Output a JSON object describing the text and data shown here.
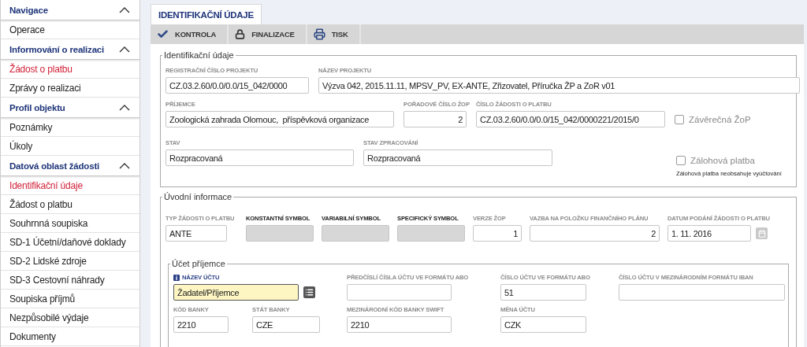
{
  "sidebar": {
    "sections": [
      {
        "title": "Navigace",
        "expanded": true,
        "items": [
          {
            "label": "Operace",
            "selected": false
          }
        ]
      },
      {
        "title": "Informování o realizaci",
        "expanded": true,
        "items": [
          {
            "label": "Žádost o platbu",
            "selected": true
          },
          {
            "label": "Zprávy o realizaci",
            "selected": false
          }
        ]
      },
      {
        "title": "Profil objektu",
        "expanded": true,
        "items": [
          {
            "label": "Poznámky",
            "selected": false
          },
          {
            "label": "Úkoly",
            "selected": false
          }
        ]
      },
      {
        "title": "Datová oblast žádosti",
        "expanded": true,
        "items": [
          {
            "label": "Identifikační údaje",
            "selected": true
          },
          {
            "label": "Žádost o platbu",
            "selected": false
          },
          {
            "label": "Souhrnná soupiska",
            "selected": false
          },
          {
            "label": "SD-1 Účetní/daňové doklady",
            "selected": false
          },
          {
            "label": "SD-2 Lidské zdroje",
            "selected": false
          },
          {
            "label": "SD-3 Cestovní náhrady",
            "selected": false
          },
          {
            "label": "Soupiska příjmů",
            "selected": false
          },
          {
            "label": "Nezpůsobilé výdaje",
            "selected": false
          },
          {
            "label": "Dokumenty",
            "selected": false
          }
        ]
      }
    ]
  },
  "tabs": [
    {
      "label": "IDENTIFIKAČNÍ ÚDAJE",
      "selected": true
    }
  ],
  "toolbar": [
    {
      "kind": "check",
      "label": "KONTROLA"
    },
    {
      "kind": "lock",
      "label": "FINALIZACE"
    },
    {
      "kind": "print",
      "label": "TISK"
    }
  ],
  "identification": {
    "legend": "Identifikační údaje",
    "fields": [
      {
        "label": "REGISTRAČNÍ ČÍSLO PROJEKTU",
        "value": "CZ.03.2.60/0.0/0.0/15_042/0000",
        "kind": "text"
      },
      {
        "label": "NÁZEV PROJEKTU",
        "value": "Výzva 042, 2015.11.11, MPSV_PV, EX-ANTE, Zřizovatel, Příručka ŽP a ZoR v01",
        "kind": "text"
      },
      {
        "label": "PŘÍJEMCE",
        "value": "Zoologická zahrada Olomouc,  příspěvková organizace",
        "kind": "text"
      },
      {
        "label": "POŘADOVÉ ČÍSLO ŽOP",
        "value": "2",
        "kind": "number"
      },
      {
        "label": "ČÍSLO ŽÁDOSTI O PLATBU",
        "value": "CZ.03.2.60/0.0/0.0/15_042/0000221/2015/0",
        "kind": "text"
      },
      {
        "label": "STAV",
        "value": "Rozpracovaná",
        "kind": "text"
      },
      {
        "label": "STAV ZPRACOVÁNÍ",
        "value": "Rozpracovaná",
        "kind": "text"
      }
    ],
    "checkboxes": [
      {
        "label": "Závěrečná ŽoP",
        "checked": false
      },
      {
        "label": "Zálohová platba",
        "checked": false
      }
    ],
    "note": "Zálohová platba neobsahuje vyúčtování"
  },
  "intro": {
    "legend": "Úvodní informace",
    "fields": [
      {
        "label": "TYP ŽÁDOSTI O PLATBU",
        "value": "ANTE",
        "kind": "text",
        "disabled": false
      },
      {
        "label": "KONSTANTNÍ SYMBOL",
        "kind": "text",
        "disabled": true
      },
      {
        "label": "VARIABILNÍ SYMBOL",
        "kind": "text",
        "disabled": true
      },
      {
        "label": "SPECIFICKÝ SYMBOL",
        "kind": "text",
        "disabled": true
      },
      {
        "label": "VERZE ŽOP",
        "value": "1",
        "kind": "number",
        "disabled": false
      },
      {
        "label": "VAZBA NA POLOŽKU FINANČNÍHO PLÁNU",
        "value": "2",
        "kind": "number",
        "disabled": false
      },
      {
        "label": "DATUM PODÁNÍ ŽÁDOSTI O PLATBU",
        "value": "1. 11. 2016",
        "kind": "date",
        "disabled": false
      }
    ]
  },
  "account": {
    "legend": "Účet příjemce",
    "fields": [
      {
        "label": "NÁZEV ÚČTU",
        "value": "Žadatel/Příjemce",
        "kind": "list",
        "focused": true
      },
      {
        "label": "PŘEDČÍSLÍ ČÍSLA ÚČTU VE FORMÁTU ABO",
        "kind": "text",
        "focused": false
      },
      {
        "label": "ČÍSLO ÚČTU VE FORMÁTU ABO",
        "value": "51",
        "kind": "text",
        "focused": false
      },
      {
        "label": "ČÍSLO ÚČTU V MEZINÁRODNÍM FORMÁTU IBAN",
        "kind": "text",
        "focused": false
      },
      {
        "label": "KÓD BANKY",
        "value": "2210",
        "kind": "text",
        "focused": false
      },
      {
        "label": "STÁT BANKY",
        "value": "CZE",
        "kind": "text",
        "focused": false
      },
      {
        "label": "MEZINÁRODNÍ KÓD BANKY SWIFT",
        "value": "2210",
        "kind": "text",
        "focused": false
      },
      {
        "label": "MĚNA ÚČTU",
        "value": "CZK",
        "kind": "text",
        "focused": false
      }
    ]
  }
}
